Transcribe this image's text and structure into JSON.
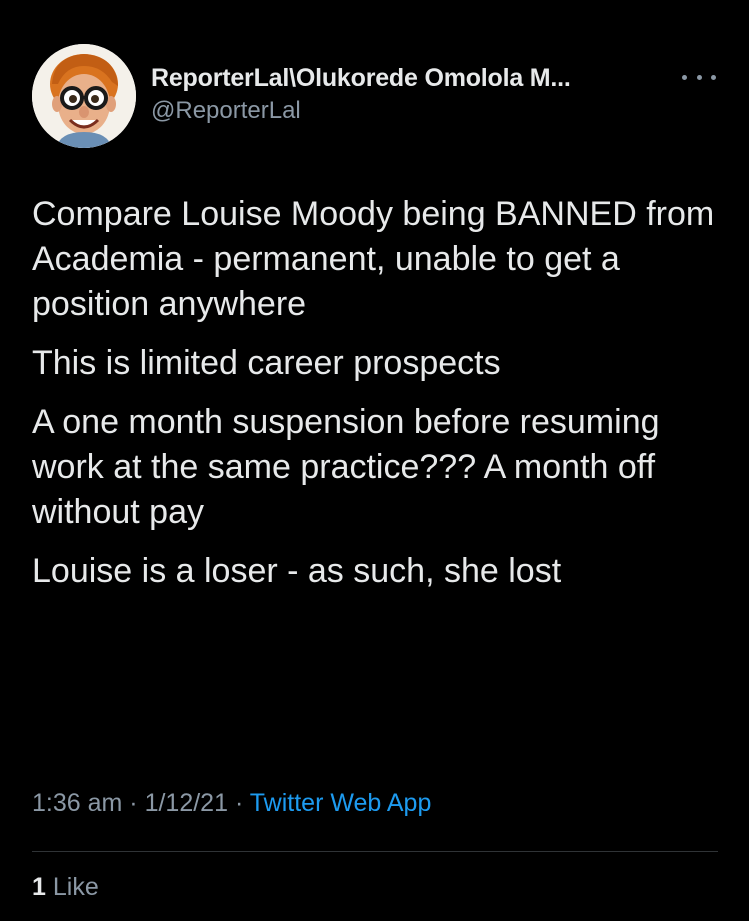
{
  "tweet": {
    "author": {
      "display_name": "ReporterLal\\Olukorede Omolola M...",
      "handle": "@ReporterLal",
      "avatar": "cartoon-man-glasses-avatar"
    },
    "more_icon": "more-horizontal-icon",
    "paragraphs": [
      "Compare Louise Moody being BANNED from Academia - permanent, unable to get a position anywhere",
      "This is limited career prospects",
      "A one month suspension before resuming work at the same practice??? A month off without pay",
      "Louise is a loser - as such, she lost"
    ],
    "time": "1:36 am",
    "separator": "·",
    "date": "1/12/21",
    "source": "Twitter Web App",
    "likes": {
      "count": "1",
      "label": "Like"
    }
  },
  "colors": {
    "background": "#000000",
    "text": "#e7e9ea",
    "secondary": "#8b98a5",
    "link": "#1d9bf0",
    "divider": "#2f3336"
  }
}
